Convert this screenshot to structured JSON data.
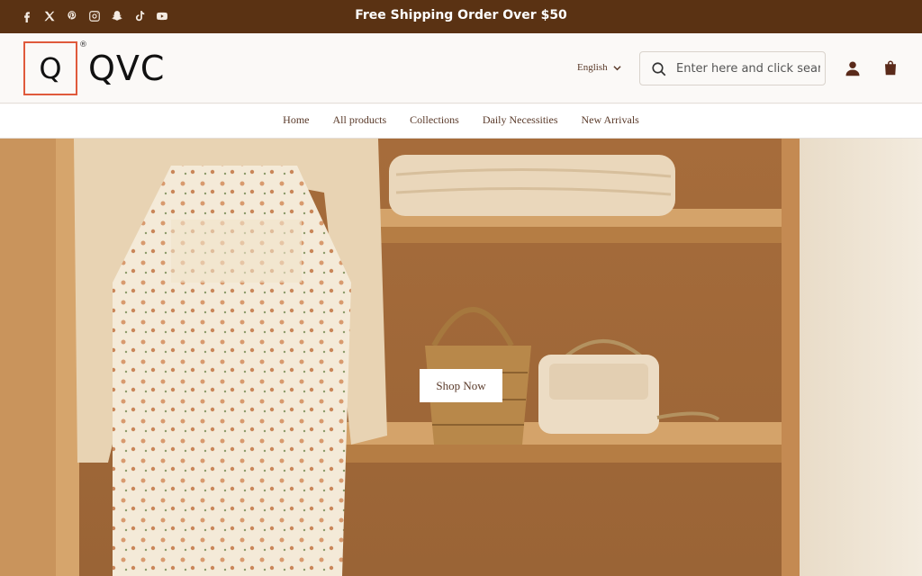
{
  "announcement": "Free Shipping Order Over $50",
  "social_icons": [
    "facebook-icon",
    "x-icon",
    "pinterest-icon",
    "instagram-icon",
    "snapchat-icon",
    "tiktok-icon",
    "youtube-icon"
  ],
  "logo": {
    "mark": "Q",
    "text": "QVC",
    "registered": "®"
  },
  "header": {
    "language": "English",
    "search_placeholder": "Enter here and click search",
    "icons": [
      "account-icon",
      "cart-icon"
    ]
  },
  "nav": {
    "items": [
      "Home",
      "All products",
      "Collections",
      "Daily Necessities",
      "New Arrivals"
    ]
  },
  "hero": {
    "button_label": "Shop Now"
  },
  "colors": {
    "announcement_bg": "#5a3213",
    "logo_accent": "#e05a3c",
    "text_brown": "#5a3a2a"
  }
}
